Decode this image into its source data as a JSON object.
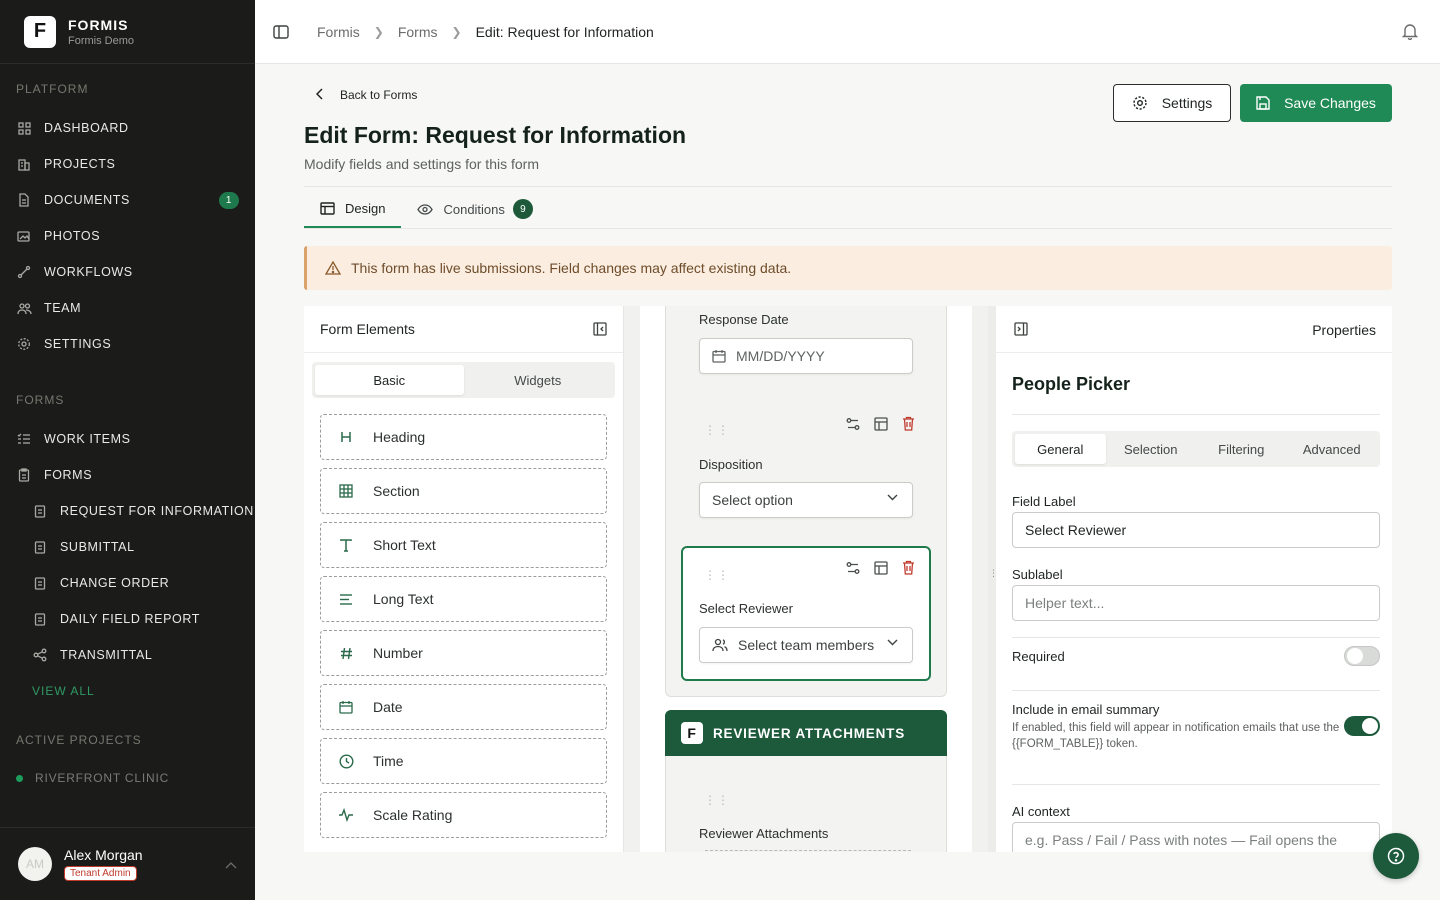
{
  "brand": {
    "name": "FORMIS",
    "workspace": "Formis Demo",
    "logo_letter": "F"
  },
  "sidebar": {
    "platform_title": "PLATFORM",
    "platform_items": [
      {
        "label": "DASHBOARD",
        "icon": "grid-icon"
      },
      {
        "label": "PROJECTS",
        "icon": "building-icon"
      },
      {
        "label": "DOCUMENTS",
        "icon": "document-icon",
        "badge": "1"
      },
      {
        "label": "PHOTOS",
        "icon": "photos-icon"
      },
      {
        "label": "WORKFLOWS",
        "icon": "workflow-icon"
      },
      {
        "label": "TEAM",
        "icon": "team-icon"
      },
      {
        "label": "SETTINGS",
        "icon": "gear-icon"
      }
    ],
    "forms_title": "FORMS",
    "forms_items": [
      {
        "label": "WORK ITEMS",
        "icon": "checklist-icon"
      },
      {
        "label": "FORMS",
        "icon": "clipboard-icon"
      }
    ],
    "form_subitems": [
      {
        "label": "REQUEST FOR INFORMATION",
        "icon": "clipboard-icon"
      },
      {
        "label": "SUBMITTAL",
        "icon": "clipboard-icon"
      },
      {
        "label": "CHANGE ORDER",
        "icon": "clipboard-icon"
      },
      {
        "label": "DAILY FIELD REPORT",
        "icon": "clipboard-icon"
      },
      {
        "label": "TRANSMITTAL",
        "icon": "share-icon"
      }
    ],
    "view_all": "VIEW ALL",
    "projects_title": "ACTIVE PROJECTS",
    "projects": [
      {
        "label": "RIVERFRONT CLINIC",
        "color": "#1e9c5d"
      }
    ]
  },
  "user": {
    "initials": "AM",
    "name": "Alex Morgan",
    "role": "Tenant Admin"
  },
  "breadcrumb": [
    "Formis",
    "Forms",
    "Edit: Request for Information"
  ],
  "header": {
    "back_label": "Back to Forms",
    "title": "Edit Form: Request for Information",
    "subtitle": "Modify fields and settings for this form",
    "settings_label": "Settings",
    "save_label": "Save Changes"
  },
  "tabs": [
    {
      "label": "Design",
      "active": true
    },
    {
      "label": "Conditions",
      "badge": "9"
    }
  ],
  "alert": "This form has live submissions. Field changes may affect existing data.",
  "form_elements": {
    "title": "Form Elements",
    "segments": [
      "Basic",
      "Widgets"
    ],
    "items": [
      {
        "label": "Heading",
        "icon": "heading-icon"
      },
      {
        "label": "Section",
        "icon": "section-grid-icon"
      },
      {
        "label": "Short Text",
        "icon": "text-icon"
      },
      {
        "label": "Long Text",
        "icon": "paragraph-icon"
      },
      {
        "label": "Number",
        "icon": "hash-icon"
      },
      {
        "label": "Date",
        "icon": "calendar-icon"
      },
      {
        "label": "Time",
        "icon": "clock-icon"
      },
      {
        "label": "Scale Rating",
        "icon": "pulse-icon"
      }
    ]
  },
  "canvas": {
    "response_date": {
      "label": "Response Date",
      "placeholder": "MM/DD/YYYY"
    },
    "disposition": {
      "label": "Disposition",
      "placeholder": "Select option"
    },
    "select_reviewer": {
      "label": "Select Reviewer",
      "placeholder": "Select team members"
    },
    "section2_title": "REVIEWER ATTACHMENTS",
    "reviewer_attachments": {
      "label": "Reviewer Attachments"
    }
  },
  "properties": {
    "panel_title": "Properties",
    "element_title": "People Picker",
    "tabs": [
      "General",
      "Selection",
      "Filtering",
      "Advanced"
    ],
    "field_label_label": "Field Label",
    "field_label_value": "Select Reviewer",
    "sublabel_label": "Sublabel",
    "sublabel_placeholder": "Helper text...",
    "required_label": "Required",
    "required_on": false,
    "email_label": "Include in email summary",
    "email_help": "If enabled, this field will appear in notification emails that use the {{FORM_TABLE}} token.",
    "email_on": true,
    "ai_label": "AI context",
    "ai_placeholder": "e.g. Pass / Fail / Pass with notes — Fail opens the"
  },
  "colors": {
    "accent": "#1f8a55",
    "sidebar_bg": "#1b1b1a",
    "section_head": "#1d5a3c",
    "danger": "#c0392b"
  }
}
